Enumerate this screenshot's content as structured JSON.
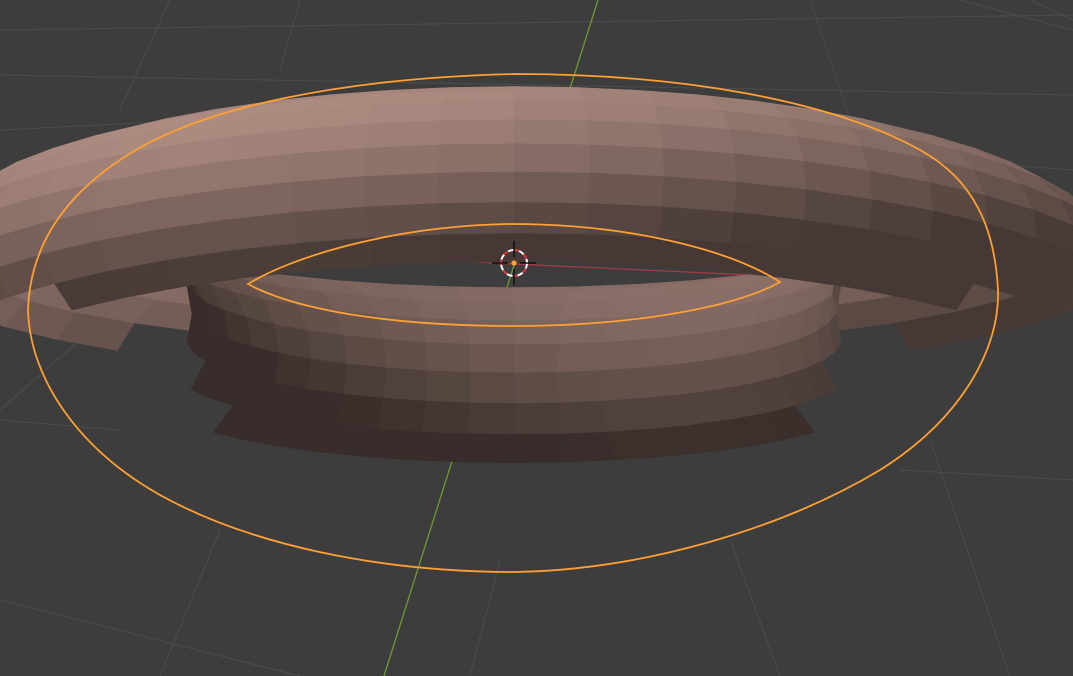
{
  "viewport": {
    "background_color": "#3d3d3d",
    "grid_color": "#4a4a4a",
    "x_axis_color": "#a33b44",
    "y_axis_color": "#6f9a2e",
    "selection_outline_color": "#ffa033",
    "mesh_base_color": "#977a71",
    "scene_objects": [
      {
        "name": "torus",
        "selected": true
      }
    ],
    "cursor_icon": "3d-cursor-icon",
    "origin_icon": "object-origin-icon"
  }
}
